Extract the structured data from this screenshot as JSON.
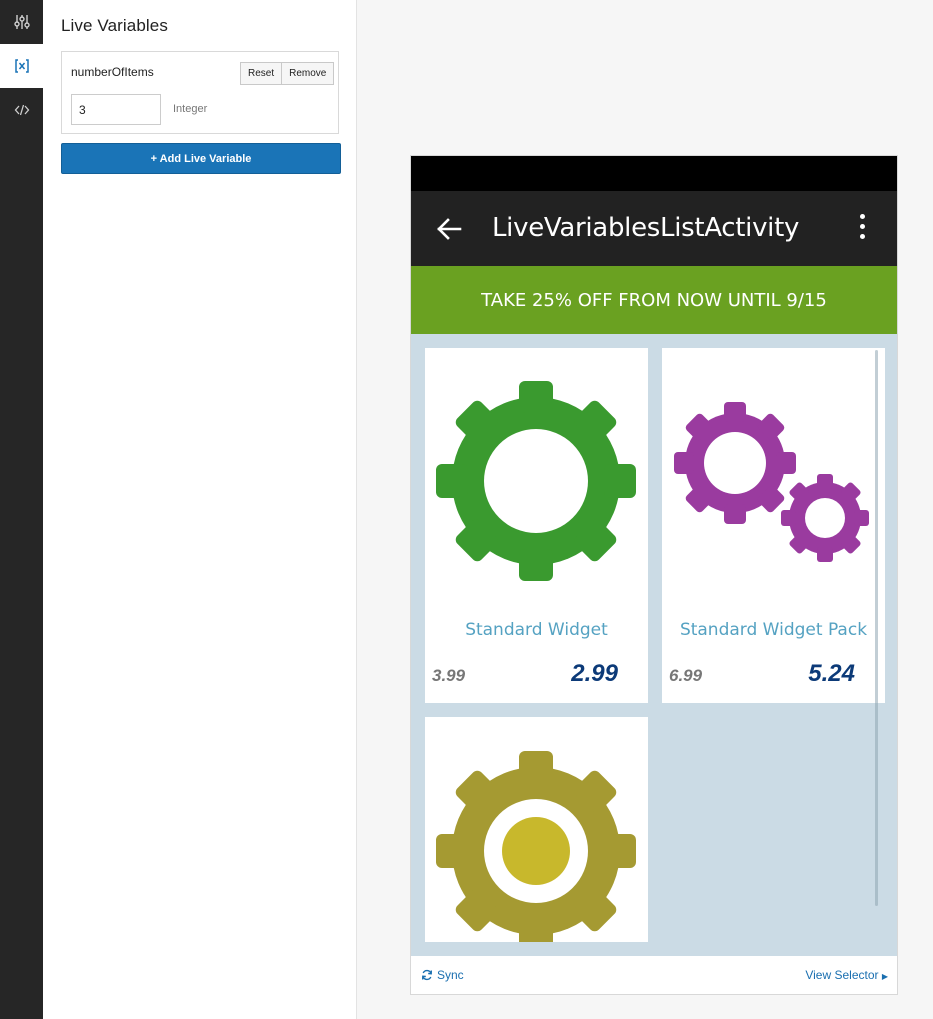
{
  "rail": {
    "items": [
      {
        "name": "settings-sliders",
        "active": false
      },
      {
        "name": "live-variables",
        "active": true
      },
      {
        "name": "code",
        "active": false
      }
    ]
  },
  "panel": {
    "title": "Live Variables",
    "variable": {
      "name": "numberOfItems",
      "value": "3",
      "type": "Integer",
      "reset_label": "Reset",
      "remove_label": "Remove"
    },
    "add_label": "+ Add Live Variable"
  },
  "device": {
    "title": "LiveVariablesListActivity",
    "promo": "TAKE 25% OFF FROM NOW UNTIL 9/15",
    "products": [
      {
        "name": "Standard Widget",
        "old_price": "3.99",
        "new_price": "2.99",
        "icon": "green-gear-icon"
      },
      {
        "name": "Standard Widget Pack",
        "old_price": "6.99",
        "new_price": "5.24",
        "icon": "purple-gears-icon"
      },
      {
        "name": "",
        "old_price": "",
        "new_price": "",
        "icon": "olive-gear-icon"
      }
    ],
    "footer": {
      "sync_label": "Sync",
      "selector_label": "View Selector"
    }
  },
  "colors": {
    "accent_blue": "#1a74b7",
    "promo_green": "#6aa121",
    "app_bar": "#222222",
    "list_bg": "#cbdbe5",
    "product_name": "#55a2c2",
    "price_new": "#0c3a78"
  }
}
